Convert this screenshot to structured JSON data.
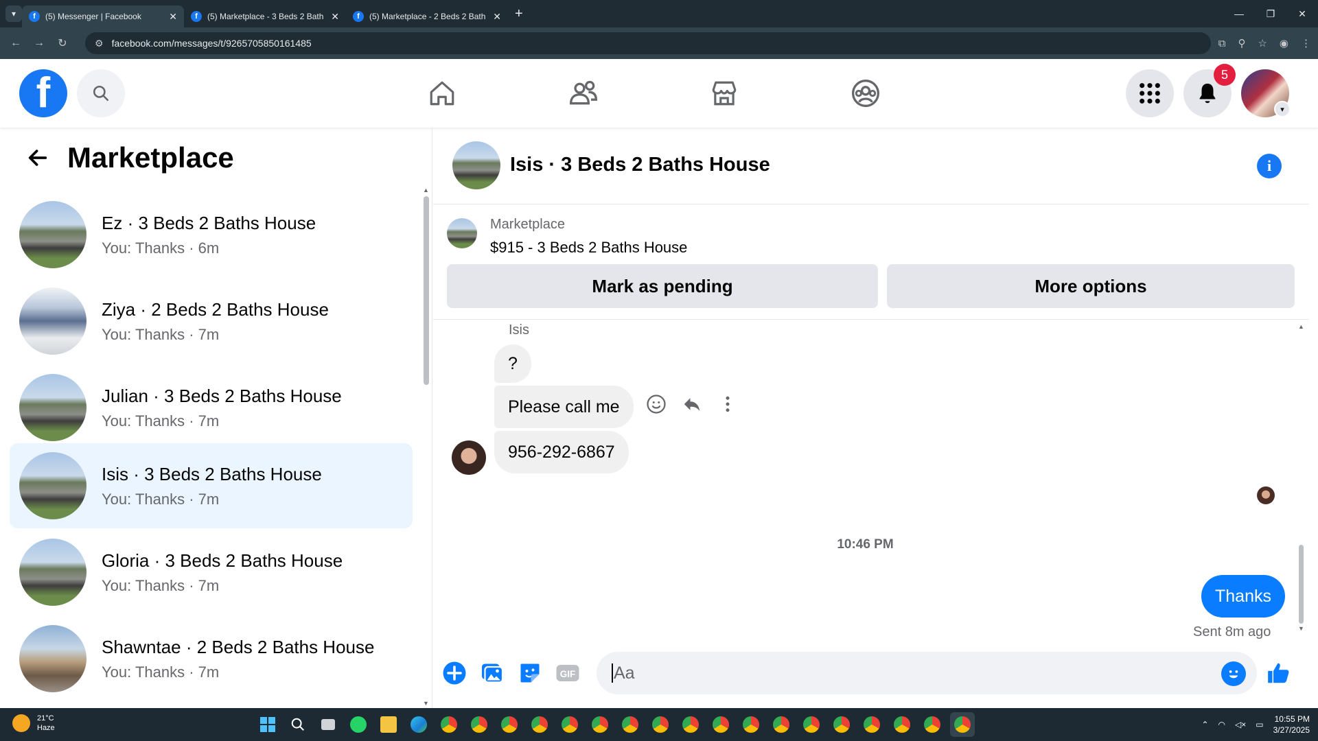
{
  "browser": {
    "tabs": [
      {
        "title": "(5) Messenger | Facebook",
        "active": true
      },
      {
        "title": "(5) Marketplace - 3 Beds 2 Bath",
        "active": false
      },
      {
        "title": "(5) Marketplace - 2 Beds 2 Bath",
        "active": false
      }
    ],
    "url": "facebook.com/messages/t/9265705850161485"
  },
  "header": {
    "logo": "f",
    "notification_count": "5",
    "icons": [
      "search-icon",
      "home-icon",
      "friends-icon",
      "marketplace-icon",
      "groups-icon",
      "menu-grid-icon",
      "bell-icon"
    ]
  },
  "sidebar": {
    "title": "Marketplace",
    "conversations": [
      {
        "name": "Ez · 3 Beds 2 Baths House",
        "preview": "You: Thanks · 6m",
        "active": false
      },
      {
        "name": "Ziya · 2 Beds 2 Baths House",
        "preview": "You: Thanks · 7m",
        "active": false
      },
      {
        "name": "Julian · 3 Beds 2 Baths House",
        "preview": "You: Thanks · 7m",
        "active": false
      },
      {
        "name": "Isis · 3 Beds 2 Baths House",
        "preview": "You: Thanks · 7m",
        "active": true
      },
      {
        "name": "Gloria · 3 Beds 2 Baths House",
        "preview": "You: Thanks · 7m",
        "active": false
      },
      {
        "name": "Shawntae · 2 Beds 2 Baths House",
        "preview": "You: Thanks · 7m",
        "active": false
      }
    ]
  },
  "chat": {
    "title": "Isis · 3 Beds 2 Baths House",
    "marketplace_label": "Marketplace",
    "listing": "$915 - 3 Beds 2 Baths House",
    "mark_pending_label": "Mark as pending",
    "more_options_label": "More options",
    "sender_name": "Isis",
    "messages": [
      {
        "from": "Isis",
        "text": "?"
      },
      {
        "from": "Isis",
        "text": "Please call me"
      },
      {
        "from": "Isis",
        "text": "956-292-6867"
      }
    ],
    "timestamp": "10:46 PM",
    "my_message": "Thanks",
    "sent_status": "Sent 8m ago",
    "composer_placeholder": "Aa"
  },
  "taskbar": {
    "temperature": "21°C",
    "condition": "Haze",
    "time": "10:55 PM",
    "date": "3/27/2025"
  },
  "colors": {
    "fb_blue": "#1877f2",
    "messenger_blue": "#0a7cff",
    "badge_red": "#e41e3f",
    "active_conv_bg": "#ebf5ff"
  }
}
